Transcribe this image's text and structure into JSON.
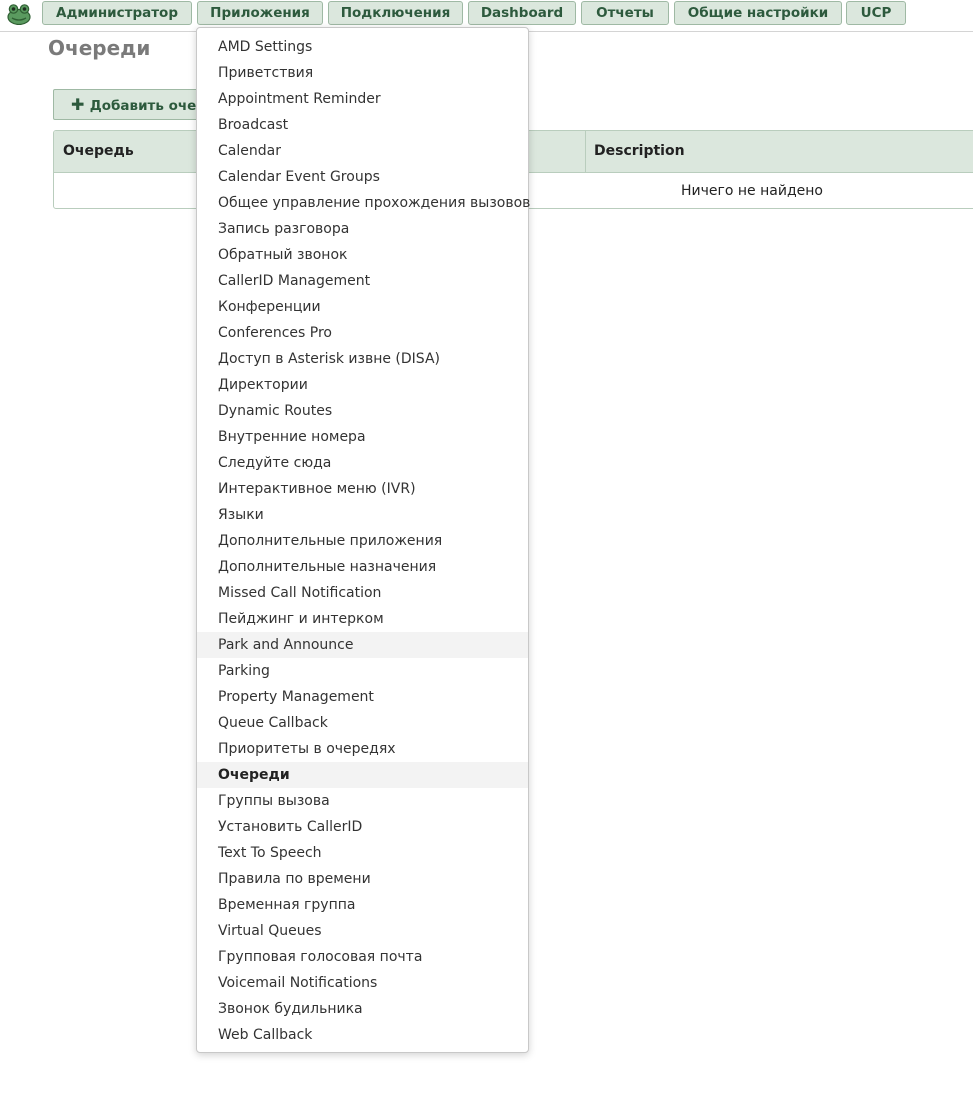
{
  "nav": {
    "logo_icon": "frog-logo-icon",
    "buttons": [
      {
        "label": "Администратор"
      },
      {
        "label": "Приложения"
      },
      {
        "label": "Подключения"
      },
      {
        "label": "Dashboard"
      },
      {
        "label": "Отчеты"
      },
      {
        "label": "Общие настройки"
      },
      {
        "label": "UCP"
      }
    ]
  },
  "page": {
    "title": "Очереди",
    "add_button_icon": "plus-icon",
    "add_button_label": "Добавить очередь"
  },
  "grid": {
    "columns": [
      "Очередь",
      "Description"
    ],
    "empty_message": "Ничего не найдено"
  },
  "dropdown": {
    "items": [
      {
        "label": "AMD Settings"
      },
      {
        "label": "Приветствия"
      },
      {
        "label": "Appointment Reminder"
      },
      {
        "label": "Broadcast"
      },
      {
        "label": "Calendar"
      },
      {
        "label": "Calendar Event Groups"
      },
      {
        "label": "Общее управление прохождения вызовов"
      },
      {
        "label": "Запись разговора"
      },
      {
        "label": "Обратный звонок"
      },
      {
        "label": "CallerID Management"
      },
      {
        "label": "Конференции"
      },
      {
        "label": "Conferences Pro"
      },
      {
        "label": "Доступ в Asterisk извне (DISA)"
      },
      {
        "label": "Директории"
      },
      {
        "label": "Dynamic Routes"
      },
      {
        "label": "Внутренние номера"
      },
      {
        "label": "Следуйте сюда"
      },
      {
        "label": "Интерактивное меню (IVR)"
      },
      {
        "label": "Языки"
      },
      {
        "label": "Дополнительные приложения"
      },
      {
        "label": "Дополнительные назначения"
      },
      {
        "label": "Missed Call Notification"
      },
      {
        "label": "Пейджинг и интерком"
      },
      {
        "label": "Park and Announce"
      },
      {
        "label": "Parking"
      },
      {
        "label": "Property Management"
      },
      {
        "label": "Queue Callback"
      },
      {
        "label": "Приоритеты в очередях"
      },
      {
        "label": "Очереди"
      },
      {
        "label": "Группы вызова"
      },
      {
        "label": "Установить CallerID"
      },
      {
        "label": "Text To Speech"
      },
      {
        "label": "Правила по времени"
      },
      {
        "label": "Временная группа"
      },
      {
        "label": "Virtual Queues"
      },
      {
        "label": "Групповая голосовая почта"
      },
      {
        "label": "Voicemail Notifications"
      },
      {
        "label": "Звонок будильника"
      },
      {
        "label": "Web Callback"
      }
    ],
    "hovered_item": "Park and Announce",
    "active_item": "Очереди"
  },
  "colors": {
    "nav_button_bg": "#dbe7dd",
    "nav_button_text": "#2d5a3d",
    "title_gray": "#7a7a7a"
  }
}
